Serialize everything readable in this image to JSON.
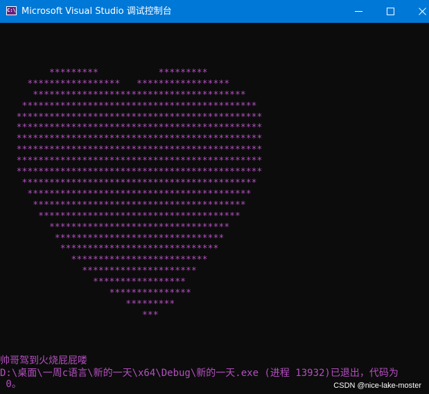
{
  "window": {
    "title": "Microsoft Visual Studio 调试控制台",
    "icon": "vs-debug-console-icon",
    "icon_text": "C:\\",
    "titlebar_color": "#0078d7",
    "text_color": "#b44fc0"
  },
  "controls": {
    "minimize": "minimize-icon",
    "maximize": "maximize-icon",
    "close": "close-icon"
  },
  "console": {
    "heart_lines": [
      "",
      "         *********           *********",
      "     *****************   *****************",
      "      ***************************************",
      "    *******************************************",
      "   *********************************************",
      "   *********************************************",
      "   *********************************************",
      "   *********************************************",
      "   *********************************************",
      "   *********************************************",
      "    *******************************************",
      "     *****************************************",
      "      ***************************************",
      "       *************************************",
      "         *********************************",
      "          *******************************",
      "           *****************************",
      "             *************************",
      "               *********************",
      "                 *****************",
      "                    ***************",
      "                       *********",
      "                          ***"
    ],
    "message": "帅哥驾到火烧屁屁喽",
    "exit_line": "D:\\桌面\\一周c语言\\新的一天\\x64\\Debug\\新的一天.exe (进程 13932)已退出，代码为",
    "exit_code": " 0。"
  },
  "watermark": "CSDN @nice-lake-moster"
}
